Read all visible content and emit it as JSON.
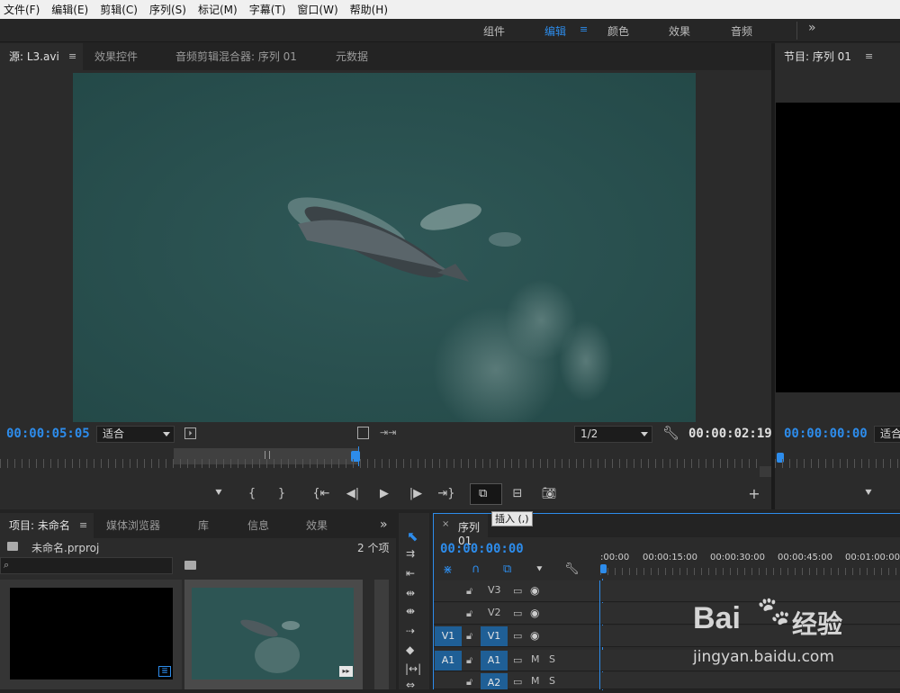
{
  "menu": [
    "文件(F)",
    "编辑(E)",
    "剪辑(C)",
    "序列(S)",
    "标记(M)",
    "字幕(T)",
    "窗口(W)",
    "帮助(H)"
  ],
  "workspaces": [
    "组件",
    "编辑",
    "颜色",
    "效果",
    "音频"
  ],
  "workspace_more": "»",
  "source": {
    "tabs": [
      "源: L3.avi",
      "效果控件",
      "音频剪辑混合器: 序列 01",
      "元数据"
    ],
    "timecode_left": "00:00:05:05",
    "fit": "适合",
    "resolution": "1/2",
    "timecode_right": "00:00:02:19"
  },
  "program": {
    "tab": "节目: 序列 01",
    "timecode": "00:00:00:00",
    "fit": "适合"
  },
  "tooltip": "插入 (,)",
  "project": {
    "tabs": [
      "项目: 未命名",
      "媒体浏览器",
      "库",
      "信息",
      "效果"
    ],
    "filename": "未命名.prproj",
    "item_count": "2 个项"
  },
  "timeline": {
    "tab": "序列 01",
    "timecode": "00:00:00:00",
    "ruler_labels": [
      ":00:00",
      "00:00:15:00",
      "00:00:30:00",
      "00:00:45:00",
      "00:01:00:00"
    ],
    "tracks": [
      {
        "source": "",
        "target": "V3",
        "kind": "video"
      },
      {
        "source": "",
        "target": "V2",
        "kind": "video"
      },
      {
        "source": "V1",
        "target": "V1",
        "kind": "video"
      },
      {
        "source": "A1",
        "target": "A1",
        "kind": "audio"
      },
      {
        "source": "",
        "target": "A2",
        "kind": "audio"
      }
    ],
    "mute": "M",
    "solo": "S"
  },
  "watermark": {
    "brand": "Bai",
    "brand2": "经验",
    "url": "jingyan.baidu.com"
  },
  "colors": {
    "accent": "#2d8ceb",
    "track_target": "#1f5f96"
  }
}
